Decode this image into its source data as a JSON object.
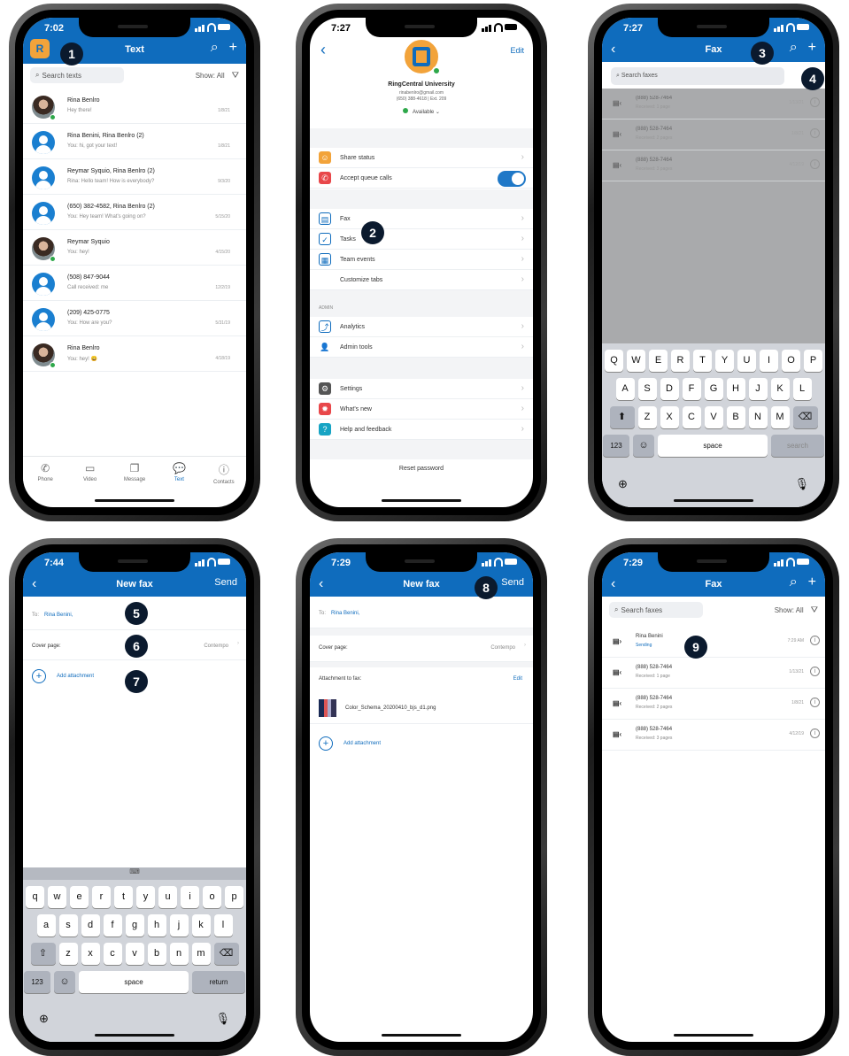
{
  "p1": {
    "time": "7:02",
    "title": "Text",
    "search": "Search texts",
    "show": "Show: All",
    "rows": [
      {
        "name": "Rina Benlro",
        "sub": "Hey there!",
        "date": "1/8/21",
        "photo": true
      },
      {
        "name": "Rina Benini, Rina Benlro (2)",
        "sub": "You: hi, got your text!",
        "date": "1/8/21",
        "photo": false
      },
      {
        "name": "Reymar Syquio, Rina Benlro (2)",
        "sub": "Rina: Hello team! How is everybody?",
        "date": "9/3/20",
        "photo": false
      },
      {
        "name": "(650) 382-4582, Rina Benlro (2)",
        "sub": "You: Hey team! What's going on?",
        "date": "5/15/20",
        "photo": false
      },
      {
        "name": "Reymar Syquio",
        "sub": "You: hey!",
        "date": "4/15/20",
        "photo": true
      },
      {
        "name": "(508) 847-9044",
        "sub": "Call received: me",
        "date": "12/2/19",
        "photo": false
      },
      {
        "name": "(209) 425-0775",
        "sub": "You: How are you?",
        "date": "5/31/19",
        "photo": false
      },
      {
        "name": "Rina Benlro",
        "sub": "You: hey! 😀",
        "date": "4/18/19",
        "photo": true
      }
    ],
    "tabs": [
      "Phone",
      "Video",
      "Message",
      "Text",
      "Contacts"
    ]
  },
  "p2": {
    "time": "7:27",
    "edit": "Edit",
    "org": "RingCentral University",
    "email": "rinabenlro@gmail.com",
    "phone": "(650) 388-4618 | Ext. 209",
    "status": "Available",
    "share": "Share status",
    "queue": "Accept queue calls",
    "fax": "Fax",
    "tasks": "Tasks",
    "team": "Team events",
    "customize": "Customize tabs",
    "admin": "ADMIN",
    "analytics": "Analytics",
    "admintools": "Admin tools",
    "settings": "Settings",
    "whatsnew": "What's new",
    "help": "Help and feedback",
    "reset": "Reset password"
  },
  "p3": {
    "time": "7:27",
    "title": "Fax",
    "search": "Search faxes",
    "rows": [
      {
        "name": "(888) 528-7464",
        "sub": "Received: 1 page",
        "date": "1/13/21"
      },
      {
        "name": "(888) 528-7464",
        "sub": "Received: 2 pages",
        "date": "1/8/21"
      },
      {
        "name": "(888) 528-7464",
        "sub": "Received: 3 pages",
        "date": "4/12/19"
      }
    ],
    "kb1": [
      "Q",
      "W",
      "E",
      "R",
      "T",
      "Y",
      "U",
      "I",
      "O",
      "P"
    ],
    "kb2": [
      "A",
      "S",
      "D",
      "F",
      "G",
      "H",
      "J",
      "K",
      "L"
    ],
    "kb3": [
      "Z",
      "X",
      "C",
      "V",
      "B",
      "N",
      "M"
    ],
    "num": "123",
    "space": "space",
    "searchkey": "search"
  },
  "p4": {
    "time": "7:44",
    "title": "New fax",
    "send": "Send",
    "to": "To:",
    "recipient": "Rina Benini,",
    "cover": "Cover page:",
    "coverval": "Contempo",
    "add": "Add attachment",
    "kb1": [
      "q",
      "w",
      "e",
      "r",
      "t",
      "y",
      "u",
      "i",
      "o",
      "p"
    ],
    "kb2": [
      "a",
      "s",
      "d",
      "f",
      "g",
      "h",
      "j",
      "k",
      "l"
    ],
    "kb3": [
      "z",
      "x",
      "c",
      "v",
      "b",
      "n",
      "m"
    ],
    "num": "123",
    "space": "space",
    "ret": "return"
  },
  "p5": {
    "time": "7:29",
    "title": "New fax",
    "send": "Send",
    "to": "To:",
    "recipient": "Rina Benini,",
    "cover": "Cover page:",
    "coverval": "Contempo",
    "attachlabel": "Attachment to fax:",
    "edit": "Edit",
    "file": "Color_Schema_20200410_bjs_d1.png",
    "add": "Add attachment"
  },
  "p6": {
    "time": "7:29",
    "title": "Fax",
    "search": "Search faxes",
    "show": "Show: All",
    "sending": {
      "name": "Rina Benini",
      "sub": "Sending",
      "date": "7:29 AM"
    },
    "rows": [
      {
        "name": "(888) 528-7464",
        "sub": "Received: 1 page",
        "date": "1/13/21"
      },
      {
        "name": "(888) 528-7464",
        "sub": "Received: 2 pages",
        "date": "1/8/21"
      },
      {
        "name": "(888) 528-7464",
        "sub": "Received: 3 pages",
        "date": "4/12/19"
      }
    ]
  },
  "badges": [
    "1",
    "2",
    "3",
    "4",
    "5",
    "6",
    "7",
    "8",
    "9"
  ],
  "colors": {
    "brand": "#0f6cbd",
    "badge": "#0b1a2e"
  }
}
